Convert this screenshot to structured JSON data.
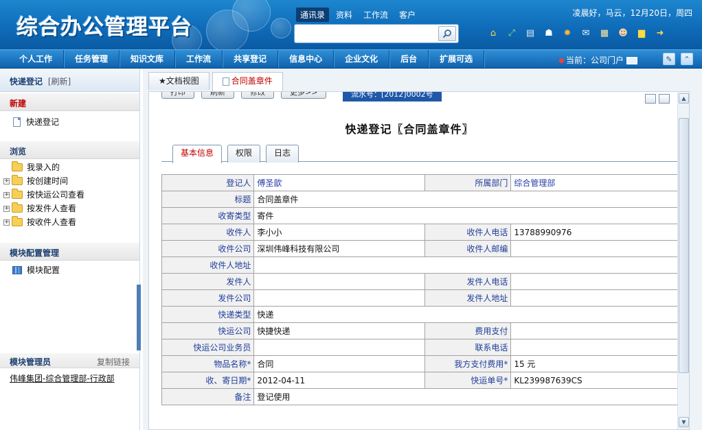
{
  "header": {
    "logo": "综合办公管理平台",
    "search_tabs": [
      "通讯录",
      "资料",
      "工作流",
      "客户"
    ],
    "search_placeholder": "",
    "greeting": "凌晨好，马云，12月20日，周四",
    "toolbar_icons": [
      "home-icon",
      "arrows-icon",
      "mail-card-icon",
      "shirt-icon",
      "settings-icon",
      "envelope-icon",
      "calendar-icon",
      "users-icon",
      "note-icon",
      "logout-icon"
    ]
  },
  "nav": {
    "items": [
      "个人工作",
      "任务管理",
      "知识文库",
      "工作流",
      "共享登记",
      "信息中心",
      "企业文化",
      "后台",
      "扩展可选"
    ],
    "current": "当前：公司门户"
  },
  "sidebar": {
    "title": "快递登记",
    "refresh": "[刷新]",
    "new_header": "新建",
    "new_item": "快递登记",
    "browse_header": "浏览",
    "browse_items": [
      "我录入的",
      "按创建时间",
      "按快运公司查看",
      "按发件人查看",
      "按收件人查看"
    ],
    "config_header": "模块配置管理",
    "config_item": "模块配置",
    "admin_label": "模块管理员",
    "copy_link": "复制链接",
    "org_path": "伟峰集团-综合管理部-行政部"
  },
  "main": {
    "tabs": [
      "★文档视图",
      "合同盖章件"
    ],
    "buttons": [
      "打印",
      "刷新",
      "修改",
      "更多>>"
    ],
    "serial": "流水号：[2012]0002号",
    "title": "快递登记〖合同盖章件〗",
    "sub_tabs": [
      "基本信息",
      "权限",
      "日志"
    ],
    "form": {
      "registrant_label": "登记人",
      "registrant": "傅圣歆",
      "dept_label": "所属部门",
      "dept": "综合管理部",
      "title_label": "标题",
      "title": "合同盖章件",
      "type_label": "收寄类型",
      "type": "寄件",
      "recipient_label": "收件人",
      "recipient": "李小小",
      "recipient_phone_label": "收件人电话",
      "recipient_phone": "13788990976",
      "recipient_company_label": "收件公司",
      "recipient_company": "深圳伟峰科技有限公司",
      "recipient_zip_label": "收件人邮编",
      "recipient_zip": "",
      "recipient_addr_label": "收件人地址",
      "recipient_addr": "",
      "sender_label": "发件人",
      "sender": "",
      "sender_phone_label": "发件人电话",
      "sender_phone": "",
      "sender_company_label": "发件公司",
      "sender_company": "",
      "sender_addr_label": "发件人地址",
      "sender_addr": "",
      "express_type_label": "快递类型",
      "express_type": "快递",
      "express_company_label": "快运公司",
      "express_company": "快捷快递",
      "fee_payment_label": "费用支付",
      "fee_payment": "",
      "courier_label": "快运公司业务员",
      "courier": "",
      "contact_phone_label": "联系电话",
      "contact_phone": "",
      "item_name_label": "物品名称",
      "item_name": "合同",
      "our_fee_label": "我方支付费用",
      "our_fee": "15 元",
      "date_label": "收、寄日期",
      "date": "2012-04-11",
      "tracking_label": "快运单号",
      "tracking": "KL239987639CS",
      "remark_label": "备注",
      "remark": "登记使用",
      "required_mark": "*"
    }
  },
  "colors": {
    "header_blue": "#0f6cb9",
    "nav_blue": "#1b77c3",
    "accent_red": "#c00000",
    "label_blue": "#1f3d99"
  }
}
